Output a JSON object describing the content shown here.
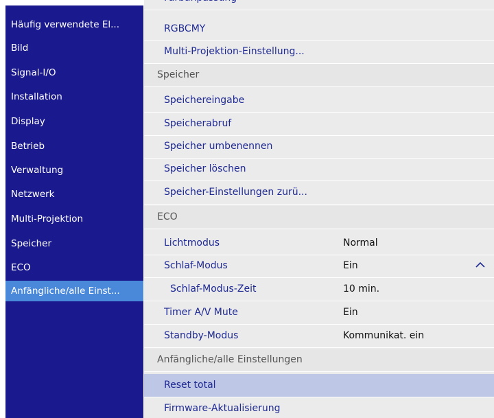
{
  "sidebar": {
    "items": [
      {
        "label": "Häufig verwendete El..."
      },
      {
        "label": "Bild"
      },
      {
        "label": "Signal-I/O"
      },
      {
        "label": "Installation"
      },
      {
        "label": "Display"
      },
      {
        "label": "Betrieb"
      },
      {
        "label": "Verwaltung"
      },
      {
        "label": "Netzwerk"
      },
      {
        "label": "Multi-Projektion"
      },
      {
        "label": "Speicher"
      },
      {
        "label": "ECO"
      },
      {
        "label": "Anfängliche/alle Einst..."
      }
    ],
    "selected_index": 11
  },
  "main": {
    "rows": [
      {
        "label": "Farbanpassung",
        "kind": "item"
      },
      {
        "label": "RGBCMY",
        "kind": "item"
      },
      {
        "label": "Multi-Projektion-Einstellung...",
        "kind": "item"
      },
      {
        "label": "Speicher",
        "kind": "section"
      },
      {
        "label": "Speichereingabe",
        "kind": "item"
      },
      {
        "label": "Speicherabruf",
        "kind": "item"
      },
      {
        "label": "Speicher umbenennen",
        "kind": "item"
      },
      {
        "label": "Speicher löschen",
        "kind": "item"
      },
      {
        "label": "Speicher-Einstellungen zurü...",
        "kind": "item"
      },
      {
        "label": "ECO",
        "kind": "section"
      },
      {
        "label": "Lichtmodus",
        "value": "Normal",
        "kind": "item"
      },
      {
        "label": "Schlaf-Modus",
        "value": "Ein",
        "kind": "item",
        "icon": "chevron-up-icon"
      },
      {
        "label": "Schlaf-Modus-Zeit",
        "value": "10 min.",
        "kind": "sub"
      },
      {
        "label": "Timer A/V Mute",
        "value": "Ein",
        "kind": "item"
      },
      {
        "label": "Standby-Modus",
        "value": "Kommunikat. ein",
        "kind": "item"
      },
      {
        "label": "Anfängliche/alle Einstellungen",
        "kind": "section"
      },
      {
        "label": "Reset total",
        "kind": "item",
        "highlighted": true
      },
      {
        "label": "Firmware-Aktualisierung",
        "kind": "item"
      }
    ]
  },
  "colors": {
    "sidebar_bg": "#1a1a8e",
    "sidebar_selected": "#4a88d9",
    "item_text": "#1f2a93",
    "row_bg": "#ebebeb",
    "highlight": "#bfc7e6"
  }
}
